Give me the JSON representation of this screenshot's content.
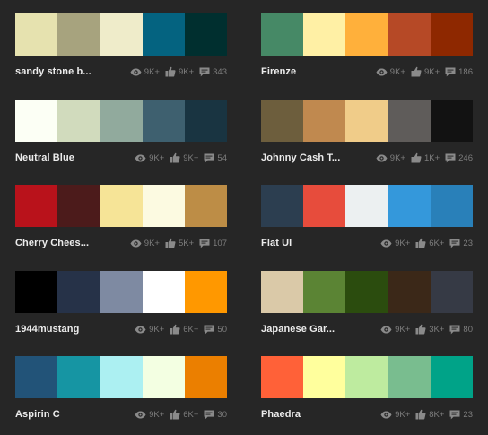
{
  "colors": {
    "background": "#262626",
    "name_text": "#ececec",
    "stat_text": "#7d7d7d",
    "icon": "#8a8a8a"
  },
  "icons": {
    "views": "eye-icon",
    "likes": "thumbs-up-icon",
    "comments": "comment-icon"
  },
  "palettes": [
    {
      "id": "sandy-stone-beach",
      "name": "sandy stone b...",
      "swatches": [
        "#E6E2AF",
        "#A7A37E",
        "#EFECCA",
        "#046380",
        "#002F2F"
      ],
      "views": "9K+",
      "likes": "9K+",
      "comments": "343"
    },
    {
      "id": "firenze",
      "name": "Firenze",
      "swatches": [
        "#468966",
        "#FFF0A5",
        "#FFB03B",
        "#B64926",
        "#8E2800"
      ],
      "views": "9K+",
      "likes": "9K+",
      "comments": "186"
    },
    {
      "id": "neutral-blue",
      "name": "Neutral Blue",
      "swatches": [
        "#FCFFF5",
        "#D1DBBD",
        "#91AA9D",
        "#3E606F",
        "#193441"
      ],
      "views": "9K+",
      "likes": "9K+",
      "comments": "54"
    },
    {
      "id": "johnny-cash",
      "name": "Johnny Cash T...",
      "swatches": [
        "#6D5E3D",
        "#C0894F",
        "#F0CC89",
        "#5F5C5A",
        "#121212"
      ],
      "views": "9K+",
      "likes": "1K+",
      "comments": "246"
    },
    {
      "id": "cherry-cheesecake",
      "name": "Cherry Chees...",
      "swatches": [
        "#B9121B",
        "#4C1B1B",
        "#F6E497",
        "#FCFAE1",
        "#BD8D46"
      ],
      "views": "9K+",
      "likes": "5K+",
      "comments": "107"
    },
    {
      "id": "flat-ui",
      "name": "Flat UI",
      "swatches": [
        "#2C3E50",
        "#E74C3C",
        "#ECF0F1",
        "#3498DB",
        "#2980B9"
      ],
      "views": "9K+",
      "likes": "6K+",
      "comments": "23"
    },
    {
      "id": "1944mustang",
      "name": "1944mustang",
      "swatches": [
        "#000000",
        "#263248",
        "#7E8AA2",
        "#FFFFFF",
        "#FF9800"
      ],
      "views": "9K+",
      "likes": "6K+",
      "comments": "50"
    },
    {
      "id": "japanese-garden",
      "name": "Japanese Gar...",
      "swatches": [
        "#DAC9A8",
        "#5B8434",
        "#2B4C0E",
        "#3B2818",
        "#363A45"
      ],
      "views": "9K+",
      "likes": "3K+",
      "comments": "80"
    },
    {
      "id": "aspirin-c",
      "name": "Aspirin C",
      "swatches": [
        "#225378",
        "#1695A3",
        "#ACF0F2",
        "#F3FFE2",
        "#EB7F00"
      ],
      "views": "9K+",
      "likes": "6K+",
      "comments": "30"
    },
    {
      "id": "phaedra",
      "name": "Phaedra",
      "swatches": [
        "#FF6138",
        "#FFFF9D",
        "#BEEB9F",
        "#79BD8F",
        "#00A388"
      ],
      "views": "9K+",
      "likes": "8K+",
      "comments": "23"
    }
  ]
}
